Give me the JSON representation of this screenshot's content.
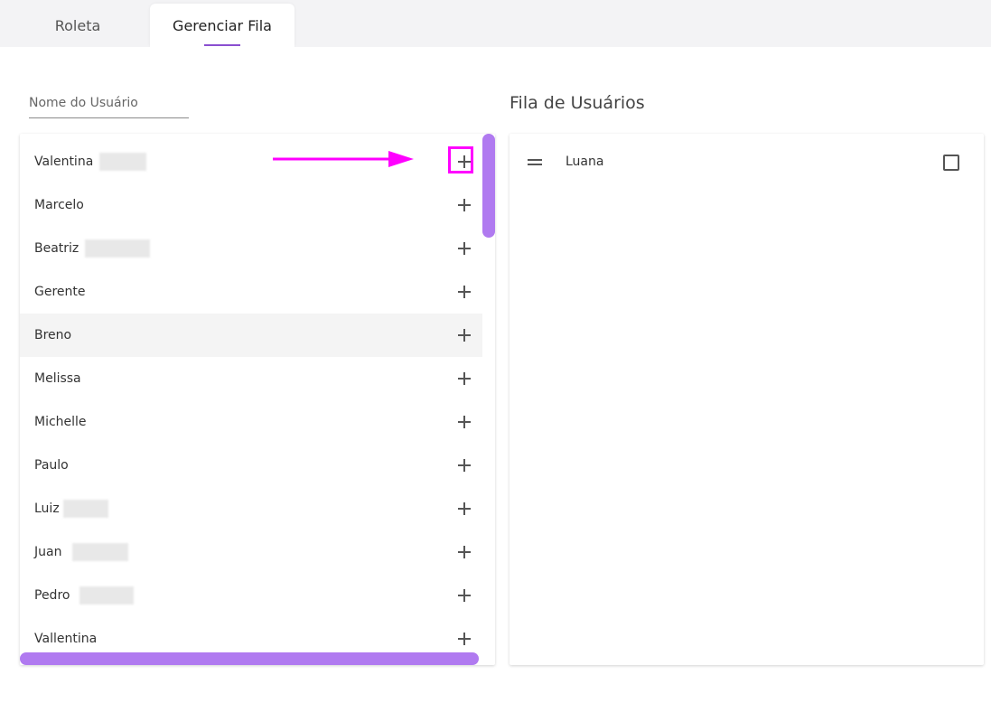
{
  "tabs": [
    {
      "label": "Roleta"
    },
    {
      "label": "Gerenciar Fila"
    }
  ],
  "search": {
    "label": "Nome do Usuário"
  },
  "users": [
    {
      "name": "Valentina"
    },
    {
      "name": "Marcelo"
    },
    {
      "name": "Beatriz"
    },
    {
      "name": "Gerente"
    },
    {
      "name": "Breno"
    },
    {
      "name": "Melissa"
    },
    {
      "name": "Michelle"
    },
    {
      "name": "Paulo"
    },
    {
      "name": "Luiz"
    },
    {
      "name": "Juan"
    },
    {
      "name": "Pedro"
    },
    {
      "name": "Vallentina"
    }
  ],
  "queue": {
    "title": "Fila de Usuários",
    "items": [
      {
        "name": "Luana"
      }
    ]
  },
  "colors": {
    "accent": "#8a4fd0",
    "scrollbar": "#b07af0",
    "annotation": "#ff00ff"
  },
  "icons": {
    "add": "plus-icon",
    "drag": "drag-handle-icon"
  }
}
